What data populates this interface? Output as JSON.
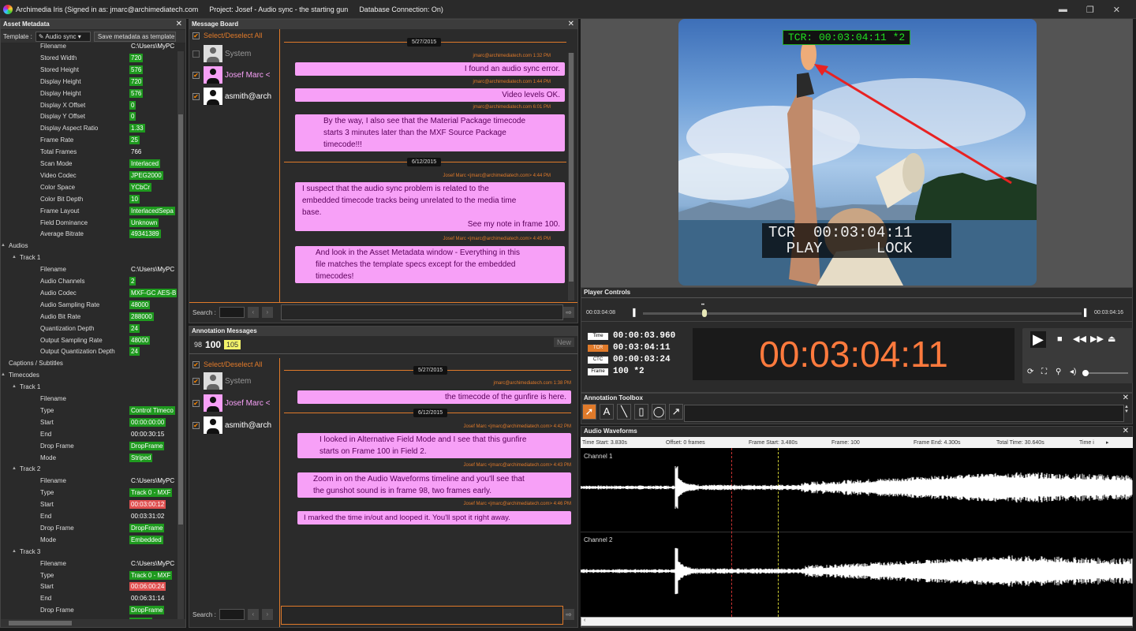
{
  "titlebar": {
    "app": "Archimedia Iris (Signed in as: jmarc@archimediatech.com",
    "project": "Project: Josef - Audio sync - the starting gun",
    "db": "Database Connection: On)"
  },
  "asset_metadata": {
    "title": "Asset Metadata",
    "template_label": "Template :",
    "template_value": "Audio sync",
    "save_button": "Save metadata as template",
    "rows": [
      {
        "indent": 2,
        "key": "Filename",
        "value": "C:\\Users\\MyPC",
        "style": "plain"
      },
      {
        "indent": 2,
        "key": "Stored Width",
        "value": "720",
        "style": "green"
      },
      {
        "indent": 2,
        "key": "Stored Height",
        "value": "576",
        "style": "green"
      },
      {
        "indent": 2,
        "key": "Display Height",
        "value": "720",
        "style": "green"
      },
      {
        "indent": 2,
        "key": "Display Height",
        "value": "576",
        "style": "green"
      },
      {
        "indent": 2,
        "key": "Display X Offset",
        "value": "0",
        "style": "green"
      },
      {
        "indent": 2,
        "key": "Display Y Offset",
        "value": "0",
        "style": "green"
      },
      {
        "indent": 2,
        "key": "Display Aspect Ratio",
        "value": "1.33",
        "style": "green"
      },
      {
        "indent": 2,
        "key": "Frame Rate",
        "value": "25",
        "style": "green"
      },
      {
        "indent": 2,
        "key": "Total Frames",
        "value": "766",
        "style": "plain"
      },
      {
        "indent": 2,
        "key": "Scan Mode",
        "value": "Interlaced",
        "style": "green"
      },
      {
        "indent": 2,
        "key": "Video Codec",
        "value": "JPEG2000",
        "style": "green"
      },
      {
        "indent": 2,
        "key": "Color Space",
        "value": "YCbCr",
        "style": "green"
      },
      {
        "indent": 2,
        "key": "Color Bit Depth",
        "value": "10",
        "style": "green"
      },
      {
        "indent": 2,
        "key": "Frame Layout",
        "value": "InterlacedSepa",
        "style": "green"
      },
      {
        "indent": 2,
        "key": "Field Dominance",
        "value": "Unknown",
        "style": "green"
      },
      {
        "indent": 2,
        "key": "Average Bitrate",
        "value": "49341389",
        "style": "green"
      },
      {
        "indent": 0,
        "key": "Audios",
        "value": "",
        "style": "plain",
        "group": "▲"
      },
      {
        "indent": 1,
        "key": "Track 1",
        "value": "",
        "style": "plain",
        "group": "▲"
      },
      {
        "indent": 2,
        "key": "Filename",
        "value": "C:\\Users\\MyPC",
        "style": "plain"
      },
      {
        "indent": 2,
        "key": "Audio Channels",
        "value": "2",
        "style": "green"
      },
      {
        "indent": 2,
        "key": "Audio Codec",
        "value": "MXF-GC AES-B",
        "style": "green"
      },
      {
        "indent": 2,
        "key": "Audio Sampling Rate",
        "value": "48000",
        "style": "green"
      },
      {
        "indent": 2,
        "key": "Audio Bit Rate",
        "value": "288000",
        "style": "green"
      },
      {
        "indent": 2,
        "key": "Quantization Depth",
        "value": "24",
        "style": "green"
      },
      {
        "indent": 2,
        "key": "Output Sampling Rate",
        "value": "48000",
        "style": "green"
      },
      {
        "indent": 2,
        "key": "Output Quantization Depth",
        "value": "24",
        "style": "green"
      },
      {
        "indent": 0,
        "key": "Captions / Subtitles",
        "value": "",
        "style": "plain",
        "group": ""
      },
      {
        "indent": 0,
        "key": "Timecodes",
        "value": "",
        "style": "plain",
        "group": "▲"
      },
      {
        "indent": 1,
        "key": "Track 1",
        "value": "",
        "style": "plain",
        "group": "▲"
      },
      {
        "indent": 2,
        "key": "Filename",
        "value": "",
        "style": "plain"
      },
      {
        "indent": 2,
        "key": "Type",
        "value": "Control Timeco",
        "style": "green"
      },
      {
        "indent": 2,
        "key": "Start",
        "value": "00:00:00:00",
        "style": "green"
      },
      {
        "indent": 2,
        "key": "End",
        "value": "00:00:30:15",
        "style": "plain"
      },
      {
        "indent": 2,
        "key": "Drop Frame",
        "value": "DropFrame",
        "style": "green"
      },
      {
        "indent": 2,
        "key": "Mode",
        "value": "Striped",
        "style": "green"
      },
      {
        "indent": 1,
        "key": "Track 2",
        "value": "",
        "style": "plain",
        "group": "▲"
      },
      {
        "indent": 2,
        "key": "Filename",
        "value": "C:\\Users\\MyPC",
        "style": "plain"
      },
      {
        "indent": 2,
        "key": "Type",
        "value": "Track 0 - MXF",
        "style": "green"
      },
      {
        "indent": 2,
        "key": "Start",
        "value": "00:03:00:12",
        "style": "red"
      },
      {
        "indent": 2,
        "key": "End",
        "value": "00:03:31:02",
        "style": "plain"
      },
      {
        "indent": 2,
        "key": "Drop Frame",
        "value": "DropFrame",
        "style": "green"
      },
      {
        "indent": 2,
        "key": "Mode",
        "value": "Embedded",
        "style": "green"
      },
      {
        "indent": 1,
        "key": "Track 3",
        "value": "",
        "style": "plain",
        "group": "▲"
      },
      {
        "indent": 2,
        "key": "Filename",
        "value": "C:\\Users\\MyPC",
        "style": "plain"
      },
      {
        "indent": 2,
        "key": "Type",
        "value": "Track 0 - MXF",
        "style": "green"
      },
      {
        "indent": 2,
        "key": "Start",
        "value": "00:06:00:24",
        "style": "red"
      },
      {
        "indent": 2,
        "key": "End",
        "value": "00:06:31:14",
        "style": "plain"
      },
      {
        "indent": 2,
        "key": "Drop Frame",
        "value": "DropFrame",
        "style": "green"
      },
      {
        "indent": 2,
        "key": "Mode",
        "value": "Striped",
        "style": "green"
      }
    ]
  },
  "message_board": {
    "title": "Message Board",
    "select_all": "Select/Deselect All",
    "users": [
      "System",
      "Josef Marc <",
      "asmith@arch"
    ],
    "dates": [
      "5/27/2015",
      "6/12/2015"
    ],
    "messages": [
      {
        "meta": "jmarc@archimediatech.com   1:32 PM",
        "lines": [
          "I found an audio sync error."
        ]
      },
      {
        "meta": "jmarc@archimediatech.com   1:44 PM",
        "lines": [
          "Video levels OK."
        ]
      },
      {
        "meta": "jmarc@archimediatech.com   6:01 PM",
        "lines": [
          "By the way, I also see that the Material Package timecode",
          "starts 3 minutes later than the MXF Source Package",
          "timecode!!!"
        ]
      },
      {
        "meta": "Josef Marc <jmarc@archimediatech.com>   4:44 PM",
        "lines": [
          "I suspect that the audio sync problem is related to the",
          "embedded timecode tracks being unrelated to the media time",
          "base.",
          "See my note in frame 100."
        ]
      },
      {
        "meta": "Josef Marc <jmarc@archimediatech.com>   4:45 PM",
        "lines": [
          "And look in the Asset Metadata window - Everything in this",
          "file matches the template specs except for the embedded",
          "timecodes!"
        ]
      }
    ],
    "search_label": "Search :"
  },
  "annotation_messages": {
    "title": "Annotation Messages",
    "frames": [
      "98",
      "100",
      "105"
    ],
    "new_button": "New",
    "select_all": "Select/Deselect All",
    "users": [
      "System",
      "Josef Marc <",
      "asmith@arch"
    ],
    "dates": [
      "5/27/2015",
      "6/12/2015"
    ],
    "messages": [
      {
        "meta": "jmarc@archimediatech.com   1:38 PM",
        "lines": [
          "the timecode of the gunfire is here."
        ]
      },
      {
        "meta": "Josef Marc <jmarc@archimediatech.com>   4:42 PM",
        "lines": [
          "I looked in Alternative Field Mode and I see that this gunfire",
          "starts on Frame 100 in Field 2."
        ]
      },
      {
        "meta": "Josef Marc <jmarc@archimediatech.com>   4:43 PM",
        "lines": [
          "Zoom in on the Audio Waveforms timeline and you'll see that",
          "the gunshot sound is in frame 98, two frames early."
        ]
      },
      {
        "meta": "Josef Marc <jmarc@archimediatech.com>   4:46 PM",
        "lines": [
          "I marked the time in/out and looped it. You'll spot it right away."
        ]
      }
    ],
    "search_label": "Search :"
  },
  "video": {
    "tcr_top": "TCR: 00:03:04:11 *2",
    "tcr_bottom_line1": "TCR  00:03:04:11",
    "tcr_bottom_line2": "  PLAY      LOCK"
  },
  "player_controls": {
    "title": "Player Controls",
    "start_time": "00:03:04:08",
    "end_time": "00:03:04:16",
    "playhead_fraction": 0.14,
    "rows": [
      {
        "label": "Time",
        "value": "00:00:03.960",
        "label_color": "#ffffff"
      },
      {
        "label": "TCR",
        "value": "00:03:04:11",
        "label_color": "#e07a2a"
      },
      {
        "label": "CTC",
        "value": "00:00:03:24",
        "label_color": "#ffffff"
      },
      {
        "label": "Frame",
        "value": "100 *2",
        "label_color": "#ffffff"
      }
    ],
    "big_timecode": "00:03:04:11"
  },
  "annotation_toolbox": {
    "title": "Annotation Toolbox"
  },
  "audio_waveforms": {
    "title": "Audio Waveforms",
    "header": {
      "time_start": "Time Start: 3.830s",
      "offset": "Offset: 0 frames",
      "frame_start": "Frame Start: 3.480s",
      "frame": "Frame: 100",
      "frame_end": "Frame End: 4.300s",
      "total_time": "Total Time: 30.640s",
      "time": "Time i"
    },
    "channels": [
      "Channel 1",
      "Channel 2"
    ]
  },
  "colors": {
    "accent": "#e07a2a",
    "bubble": "#f7a0f7",
    "green": "#1f9a1f",
    "red": "#e05050",
    "timecode": "#ff7a3d"
  }
}
